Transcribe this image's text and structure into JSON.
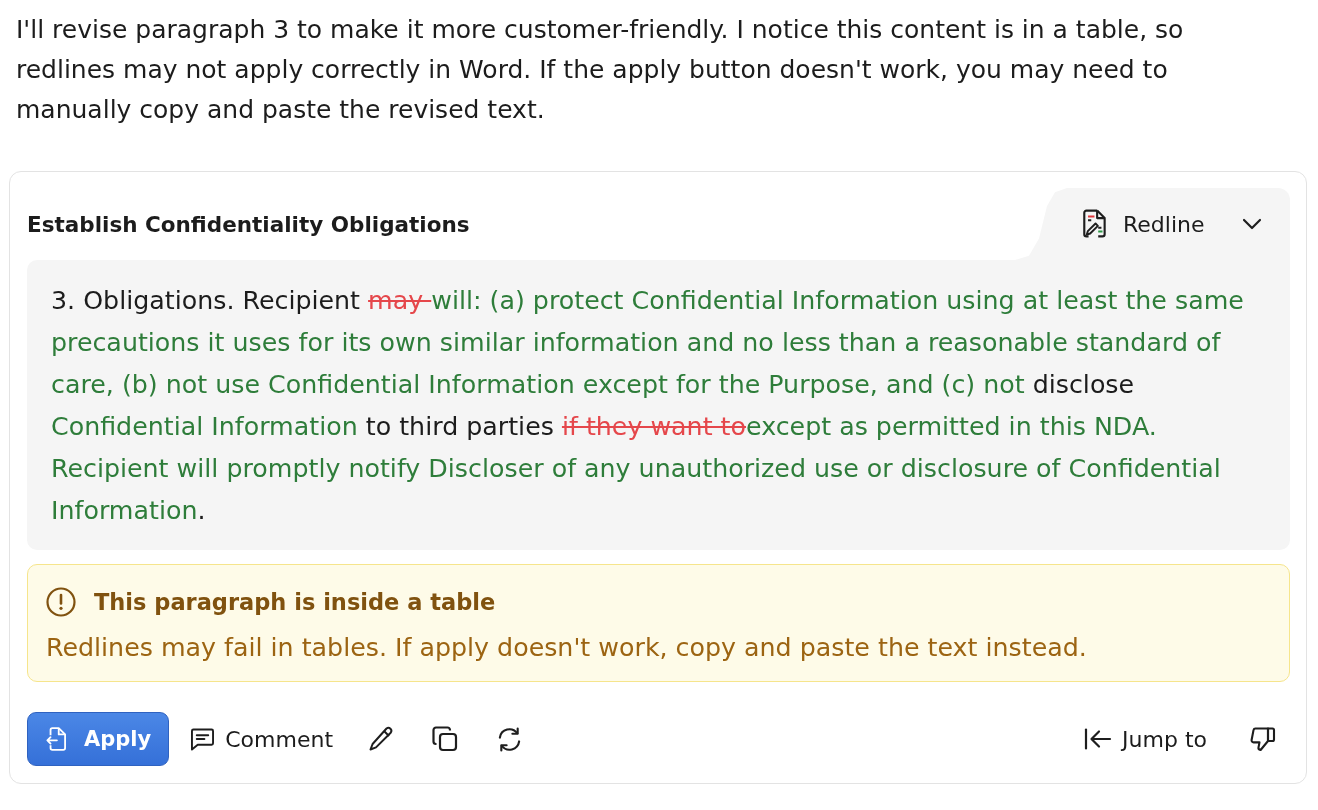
{
  "message": "I'll revise paragraph 3 to make it more customer-friendly. I notice this content is in a table, so redlines may not apply correctly in Word. If the apply button doesn't work, you may need to manually copy and paste the revised text.",
  "card": {
    "title": "Establish Confidentiality Obligations",
    "mode_dropdown": {
      "label": "Redline"
    },
    "paragraph": [
      {
        "kind": "plain",
        "text": "3. Obligations. Recipient "
      },
      {
        "kind": "deleted",
        "text": "may "
      },
      {
        "kind": "inserted",
        "text": "will: (a) protect Confidential Information using at least the same precautions it uses for its own similar information and no less than a reasonable standard of care, (b) not use Confidential Information except for the Purpose, and (c) not "
      },
      {
        "kind": "plain",
        "text": "disclose "
      },
      {
        "kind": "inserted",
        "text": "Confidential Information"
      },
      {
        "kind": "plain",
        "text": " to third parties "
      },
      {
        "kind": "deleted",
        "text": "if they want to"
      },
      {
        "kind": "inserted",
        "text": "except as permitted in this NDA. Recipient will promptly notify Discloser of any unauthorized use or disclosure of Confidential Information"
      },
      {
        "kind": "plain",
        "text": "."
      }
    ],
    "warning": {
      "title": "This paragraph is inside a table",
      "body": "Redlines may fail in tables. If apply doesn't work, copy and paste the text instead."
    },
    "actions": {
      "apply": "Apply",
      "comment": "Comment",
      "jump_to": "Jump to"
    }
  }
}
